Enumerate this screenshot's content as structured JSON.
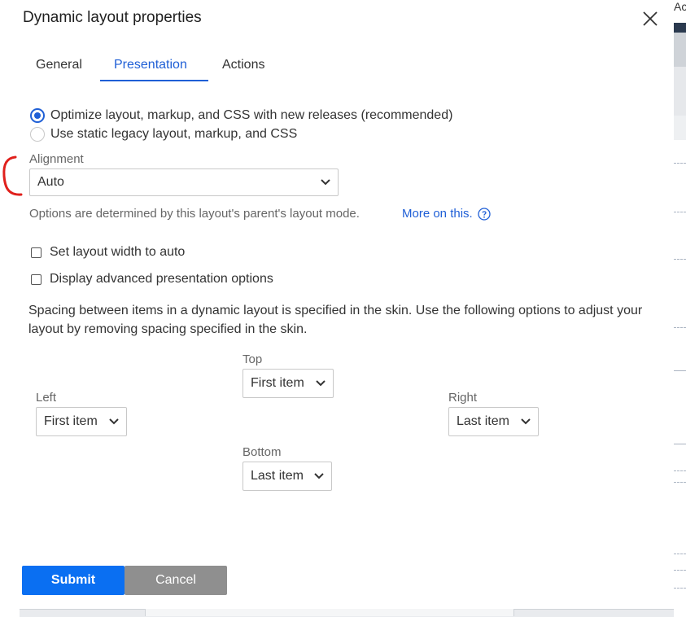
{
  "dialog": {
    "title": "Dynamic layout properties",
    "tabs": [
      {
        "label": "General",
        "active": false
      },
      {
        "label": "Presentation",
        "active": true
      },
      {
        "label": "Actions",
        "active": false
      }
    ],
    "layout_mode": {
      "options": [
        {
          "label": "Optimize layout, markup, and CSS with new releases (recommended)",
          "selected": true
        },
        {
          "label": "Use static legacy layout, markup, and CSS",
          "selected": false
        }
      ]
    },
    "alignment": {
      "label": "Alignment",
      "value": "Auto",
      "helper": "Options are determined by this layout's parent's layout mode.",
      "link": "More on this."
    },
    "checkboxes": [
      {
        "label": "Set layout width to auto",
        "checked": false
      },
      {
        "label": "Display advanced presentation options",
        "checked": false
      }
    ],
    "spacing_text": "Spacing between items in a dynamic layout is specified in the skin. Use the following options to adjust your layout by removing spacing specified in the skin.",
    "spacing": {
      "top": {
        "label": "Top",
        "value": "First item"
      },
      "left": {
        "label": "Left",
        "value": "First item"
      },
      "right": {
        "label": "Right",
        "value": "Last item"
      },
      "bottom": {
        "label": "Bottom",
        "value": "Last item"
      }
    },
    "buttons": {
      "submit": "Submit",
      "cancel": "Cancel"
    }
  },
  "background": {
    "corner_text": "Ac"
  },
  "colors": {
    "accent": "#1f5fd6",
    "submit": "#0a6ff2",
    "cancel": "#8f8f8f",
    "annotation": "#e0201c"
  },
  "icons": [
    "close-icon",
    "chevron-down-icon",
    "help-circle-icon"
  ]
}
